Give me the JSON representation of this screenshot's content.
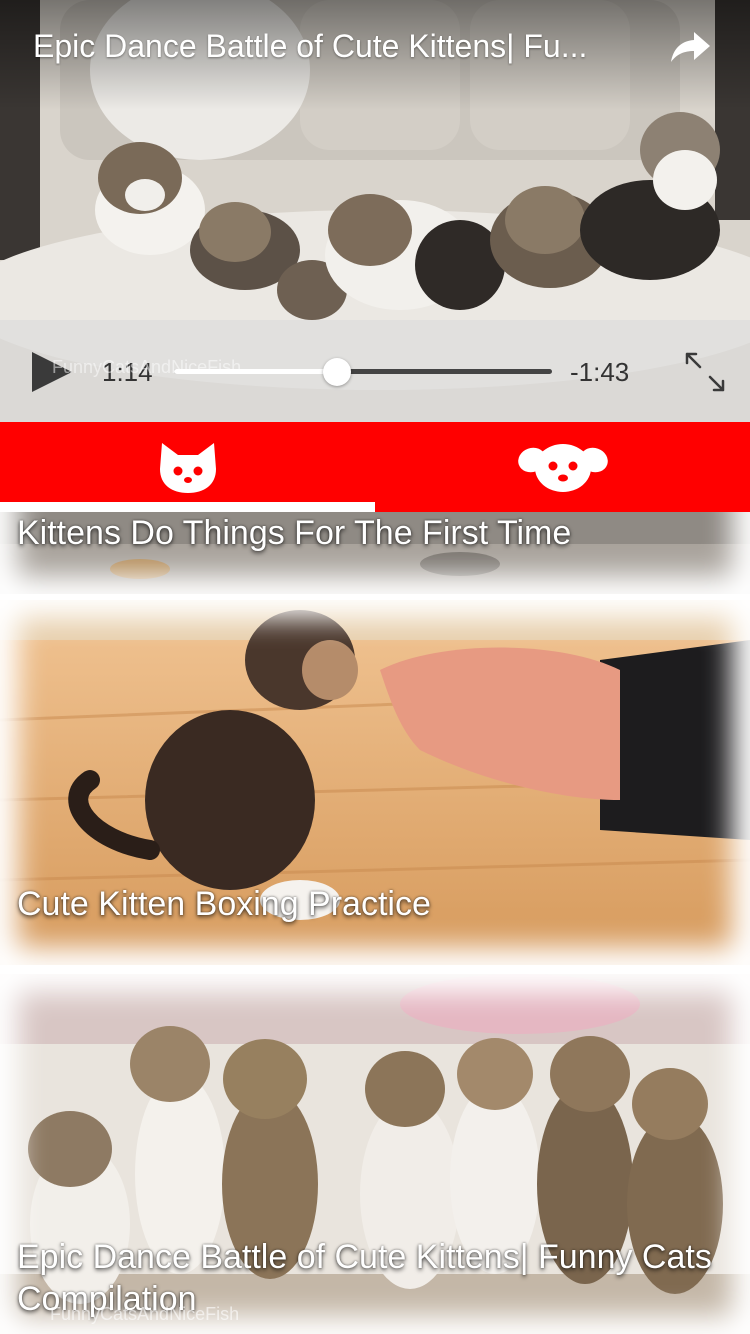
{
  "player": {
    "title": "Epic Dance Battle of Cute Kittens| Fu...",
    "current_time": "1:14",
    "remaining_time": "-1:43",
    "progress": 0.43,
    "watermark": "FunnyCatsAndNiceFish",
    "icons": {
      "share": "share-arrow-icon",
      "play": "play-icon",
      "fullscreen": "expand-icon"
    }
  },
  "tabs": [
    {
      "icon": "cat-face-icon",
      "selected": true
    },
    {
      "icon": "dog-face-icon",
      "selected": false
    }
  ],
  "videos": [
    {
      "title": "Kittens Do Things For The First Time"
    },
    {
      "title": "Cute Kitten Boxing Practice"
    },
    {
      "title": "Epic Dance Battle of Cute Kittens| Funny Cats Compilation",
      "watermark": "FunnyCatsAndNiceFish"
    }
  ],
  "colors": {
    "tab_bar": "#ff0000",
    "tab_indicator": "#ffffff",
    "title_text": "#ffffff"
  }
}
